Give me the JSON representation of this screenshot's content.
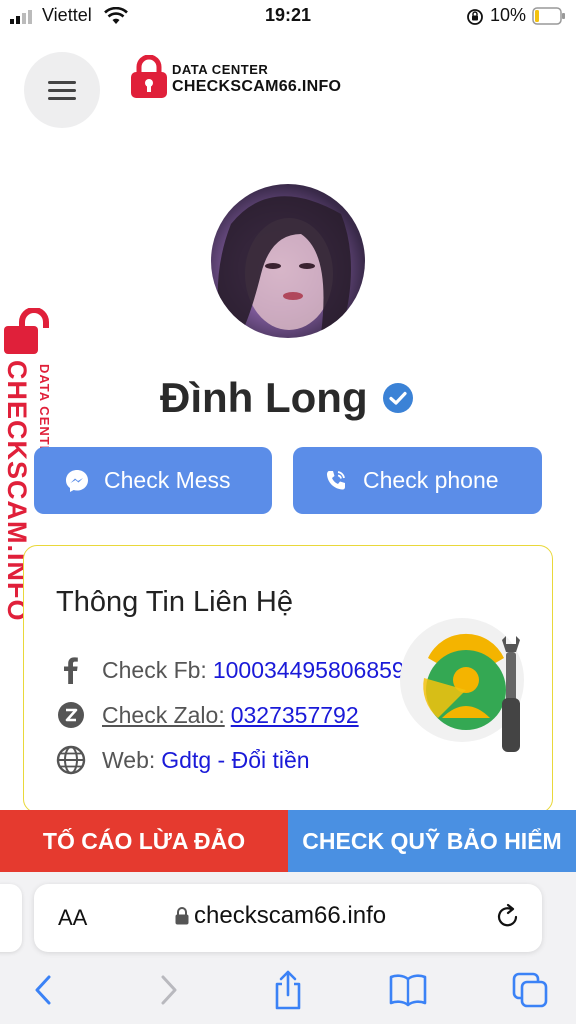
{
  "status_bar": {
    "carrier": "Viettel",
    "time": "19:21",
    "battery": "10%"
  },
  "header": {
    "logo_top": "DATA CENTER",
    "logo_main": "CHECKSCAM66.INFO"
  },
  "watermark": {
    "top": "DATA CENTER",
    "main": "CHECKSCAM.INFO"
  },
  "profile": {
    "name": "Đình Long",
    "verified": true
  },
  "actions": {
    "check_mess": "Check Mess",
    "check_phone": "Check phone"
  },
  "contact": {
    "title": "Thông Tin Liên Hệ",
    "fb_label": "Check Fb:",
    "fb_value": "100034495806859",
    "zalo_label": "Check Zalo:",
    "zalo_value": "0327357792",
    "web_label": "Web:",
    "web_value": "Gdtg - Đổi tiền"
  },
  "banners": {
    "report": "TỐ CÁO LỪA ĐẢO",
    "fund": "CHECK QUỸ BẢO HIỂM"
  },
  "browser": {
    "aa": "AA",
    "url": "checkscam66.info"
  },
  "colors": {
    "primary_button": "#5b8de8",
    "report_banner": "#e53a2f",
    "fund_banner": "#4a90e2",
    "link": "#1a1ad8",
    "card_border": "#e9d83a",
    "brand_red": "#e0203a"
  }
}
